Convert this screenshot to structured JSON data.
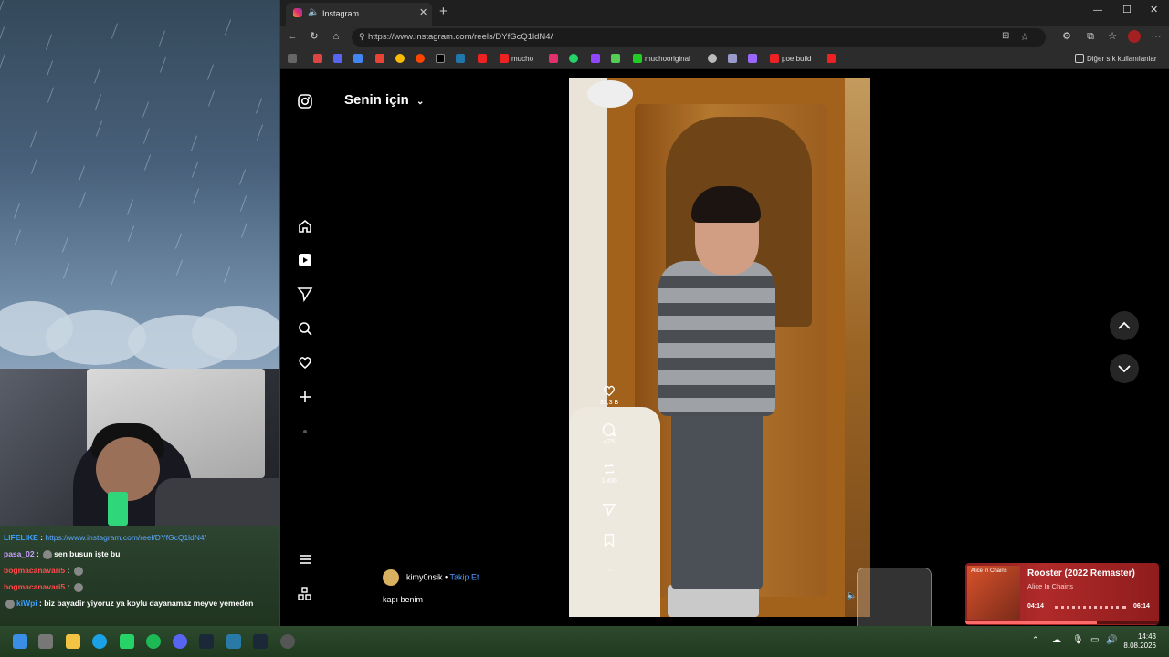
{
  "browser": {
    "tab_title": "Instagram",
    "url": "https://www.instagram.com/reels/DYfGcQ1ldN4/",
    "bookmarks": [
      "mucho",
      "muchooriginal",
      "poe build"
    ],
    "other_bookmarks": "Diğer sık kullanılanlar"
  },
  "instagram": {
    "feed_title": "Senin için",
    "nav": [
      "home-icon",
      "reels-icon",
      "send-icon",
      "search-icon",
      "heart-icon",
      "plus-icon",
      "more-icon",
      "menu-icon",
      "apps-icon"
    ],
    "reel": {
      "likes": "33,3 B",
      "comments": "475",
      "reposts": "1.490",
      "author": "kimy0nsik",
      "follow": "Takip Et",
      "caption": "kapı benim"
    }
  },
  "music_widget": {
    "title": "Rooster (2022 Remaster)",
    "artist": "Alice In Chains",
    "elapsed": "04:14",
    "duration": "06:14",
    "album_text": "Alice in Chains",
    "progress": 0.68
  },
  "chat": {
    "lines": [
      {
        "user": "LIFELIKE",
        "sep": " : ",
        "text": "https://www.instagram.com/reel/DYfGcQ1ldN4/",
        "color": "blue",
        "link": true
      },
      {
        "user": "pasa_02",
        "sep": " : ",
        "text": "sen busun işte bu",
        "color": "pink",
        "link": false
      },
      {
        "user": "bogmacanavari5",
        "sep": " : ",
        "text": "",
        "color": "red",
        "link": false
      },
      {
        "user": "bogmacanavari5",
        "sep": " : ",
        "text": "",
        "color": "red",
        "link": false
      },
      {
        "user": "kiWpi",
        "sep": " : ",
        "text": "biz bayadir yiyoruz ya koylu dayanamaz meyve yemeden",
        "color": "blue",
        "link": false
      }
    ]
  },
  "taskbar": {
    "time": "14:43",
    "date": "8.08.2026"
  }
}
